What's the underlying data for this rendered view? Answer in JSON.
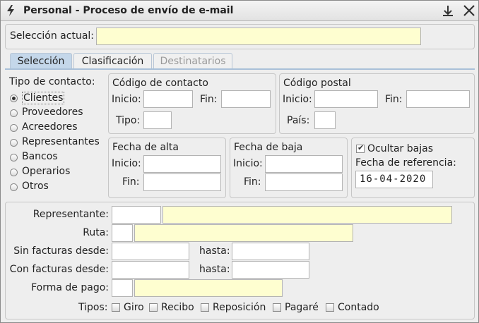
{
  "window": {
    "title": "Personal - Proceso de envío de e-mail"
  },
  "selection": {
    "label": "Selección actual:",
    "value": ""
  },
  "tabs": [
    {
      "label": "Selección",
      "state": "active"
    },
    {
      "label": "Clasificación",
      "state": "normal"
    },
    {
      "label": "Destinatarios",
      "state": "disabled"
    }
  ],
  "contact_type": {
    "label": "Tipo de contacto:",
    "options": [
      "Clientes",
      "Proveedores",
      "Acreedores",
      "Representantes",
      "Bancos",
      "Operarios",
      "Otros"
    ],
    "selected": "Clientes"
  },
  "codigo_contacto": {
    "title": "Código de contacto",
    "inicio": "Inicio:",
    "fin": "Fin:",
    "tipo": "Tipo:"
  },
  "codigo_postal": {
    "title": "Código postal",
    "inicio": "Inicio:",
    "fin": "Fin:",
    "pais": "País:"
  },
  "fecha_alta": {
    "title": "Fecha de alta",
    "inicio": "Inicio:",
    "fin": "Fin:"
  },
  "fecha_baja": {
    "title": "Fecha de baja",
    "inicio": "Inicio:",
    "fin": "Fin:"
  },
  "bajas": {
    "ocultar_label": "Ocultar bajas",
    "ocultar_checked": true,
    "ref_label": "Fecha de referencia:",
    "ref_value": "16-04-2020"
  },
  "filters": {
    "representante": "Representante:",
    "ruta": "Ruta:",
    "sin_facturas": "Sin facturas desde:",
    "con_facturas": "Con facturas desde:",
    "hasta": "hasta:",
    "forma_pago": "Forma de pago:"
  },
  "tipos": {
    "label": "Tipos:",
    "items": [
      "Giro",
      "Recibo",
      "Reposición",
      "Pagaré",
      "Contado"
    ]
  }
}
